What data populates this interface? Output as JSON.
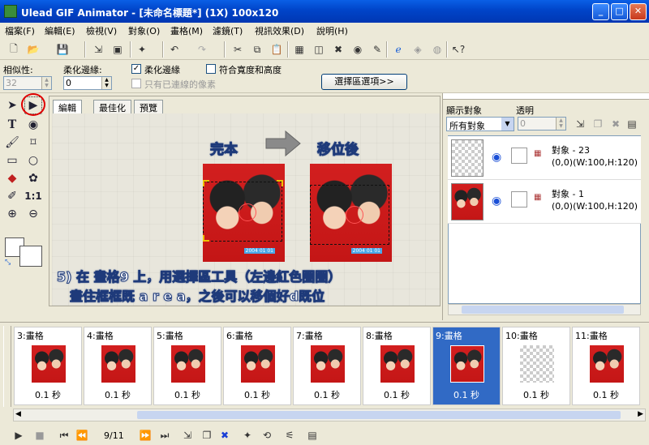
{
  "window": {
    "title": "Ulead GIF Animator - [未命名標題*] (1X) 100x120",
    "minimize": "_",
    "maximize": "□",
    "close": "✕"
  },
  "menu": [
    "檔案(F)",
    "編輯(E)",
    "檢視(V)",
    "對象(O)",
    "畫格(M)",
    "濾鏡(T)",
    "視訊效果(D)",
    "說明(H)"
  ],
  "options": {
    "similarity_label": "相似性:",
    "similarity_value": "32",
    "feather_label": "柔化邊緣:",
    "feather_value": "0",
    "feather_check_label": "柔化邊緣",
    "feather_checked": true,
    "fit_label": "符合寬度和高度",
    "fit_checked": false,
    "contiguous_label": "只有已連線的像素",
    "contiguous_checked": false,
    "select_button": "選擇區選項>>"
  },
  "tabs": [
    "編輯",
    "最佳化",
    "預覽"
  ],
  "overlay": {
    "before": "完本",
    "after": "移位後",
    "line1": "5) 在 畫格9 上，用選擇區工具（左邊紅色圈圈）",
    "line2": "畫住框框既 a r e a，之後可以移個好d既位",
    "date_stamp": "2004 01 01",
    "tool_size": "1:1"
  },
  "objects_panel": {
    "show_label": "顯示對象",
    "show_value": "所有對象",
    "opacity_label": "透明",
    "opacity_value": "0",
    "items": [
      {
        "name": "對象 - 23",
        "info": "(0,0)(W:100,H:120)"
      },
      {
        "name": "對象 - 1",
        "info": "(0,0)(W:100,H:120)"
      }
    ]
  },
  "frames": [
    {
      "label": "3:畫格",
      "delay": "0.1 秒"
    },
    {
      "label": "4:畫格",
      "delay": "0.1 秒"
    },
    {
      "label": "5:畫格",
      "delay": "0.1 秒"
    },
    {
      "label": "6:畫格",
      "delay": "0.1 秒"
    },
    {
      "label": "7:畫格",
      "delay": "0.1 秒"
    },
    {
      "label": "8:畫格",
      "delay": "0.1 秒"
    },
    {
      "label": "9:畫格",
      "delay": "0.1 秒"
    },
    {
      "label": "10:畫格",
      "delay": "0.1 秒"
    },
    {
      "label": "11:畫格",
      "delay": "0.1 秒"
    }
  ],
  "playback": {
    "counter": "9/11"
  }
}
